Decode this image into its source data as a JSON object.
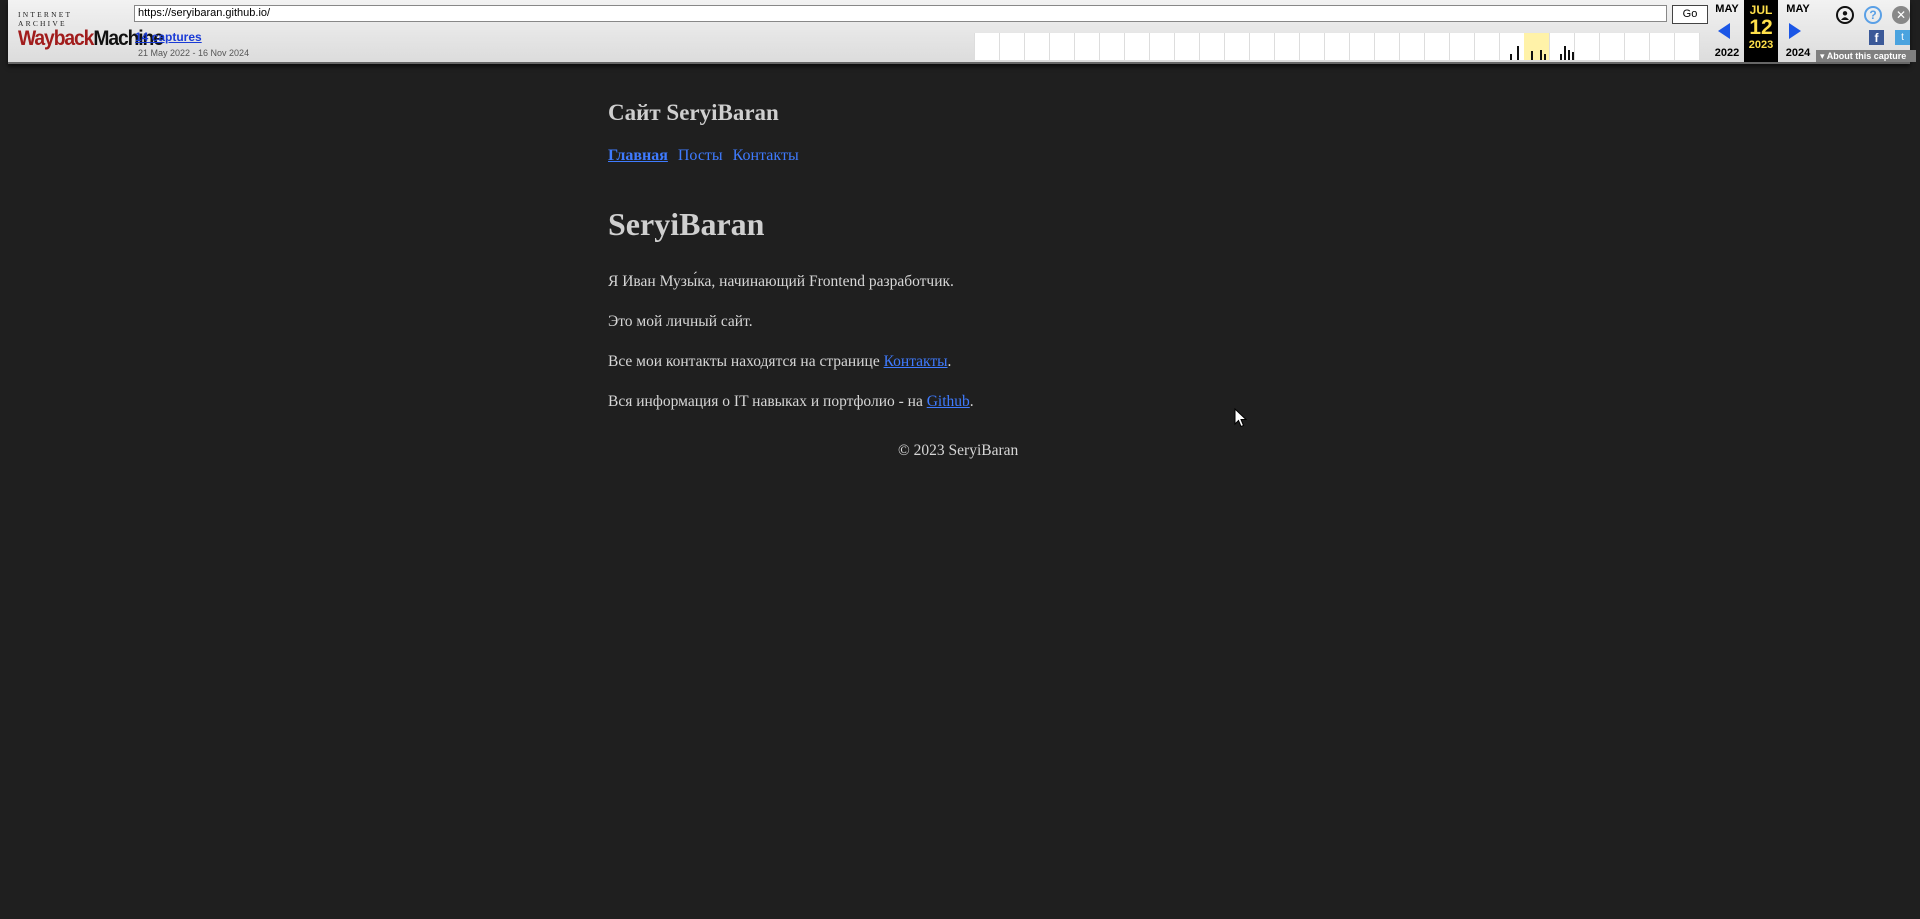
{
  "wayback": {
    "logo_top": "INTERNET ARCHIVE",
    "logo_main_a": "Wayback",
    "logo_main_b": "Machine",
    "url_value": "https://seryibaran.github.io/",
    "go_label": "Go",
    "captures_link": "14 captures",
    "date_range": "21 May 2022 - 16 Nov 2024",
    "prev_month": "MAY",
    "prev_year": "2022",
    "current_month": "JUL",
    "current_day": "12",
    "current_year": "2023",
    "next_month": "MAY",
    "next_year": "2024",
    "about_label": "About this capture",
    "user_icon": "user-icon",
    "help_icon": "help-icon",
    "close_icon": "close-icon",
    "facebook_icon": "facebook-icon",
    "twitter_icon": "twitter-icon",
    "help_glyph": "?",
    "close_glyph": "✕",
    "fb_glyph": "f",
    "tw_glyph": "t",
    "about_glyph": "▾"
  },
  "site": {
    "title": "Сайт SeryiBaran",
    "nav": [
      {
        "label": "Главная",
        "active": true
      },
      {
        "label": "Посты",
        "active": false
      },
      {
        "label": "Контакты",
        "active": false
      }
    ],
    "heading": "SeryiBaran",
    "p1": "Я Иван Музы́ка, начинающий Frontend разработчик.",
    "p2": "Это мой личный сайт.",
    "p3_text": "Все мои контакты находятся на странице ",
    "p3_link": "Контакты",
    "p3_end": ".",
    "p4_text": "Вся информация о IT навыках и портфолио - на ",
    "p4_link": "Github",
    "p4_end": ".",
    "footer": "© 2023 SeryiBaran"
  },
  "colors": {
    "page_bg": "#1f1f1f",
    "text": "#d6d6d6",
    "link": "#3f7bff",
    "wayback_accent": "#ffe04a"
  }
}
